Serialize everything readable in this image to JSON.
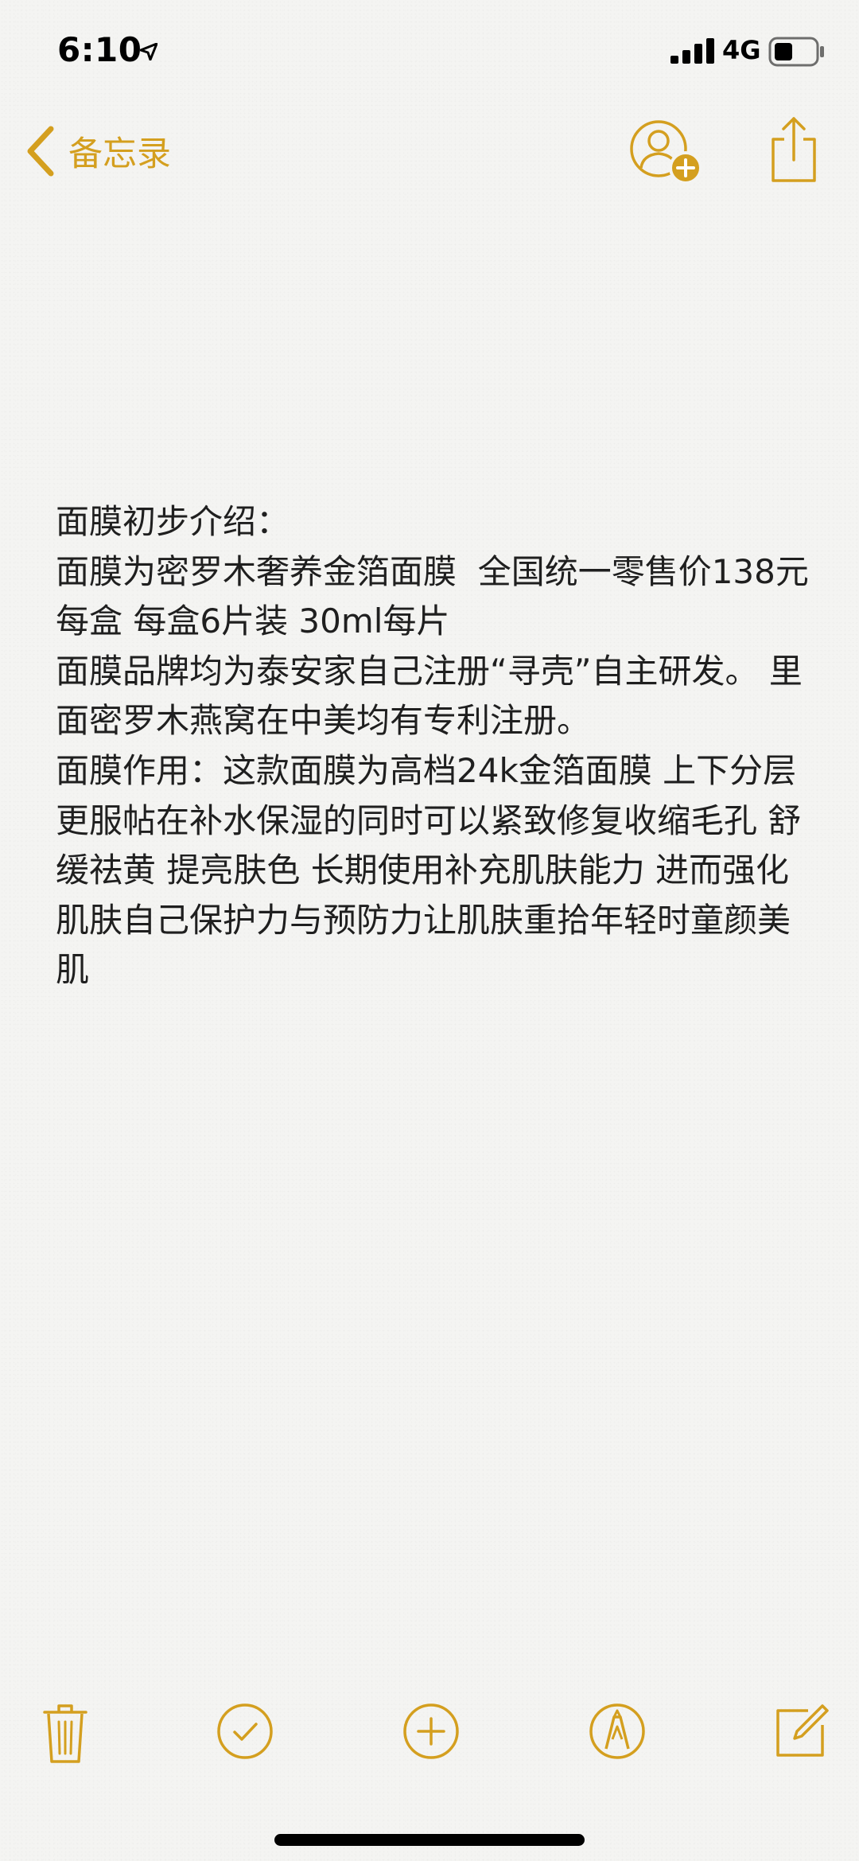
{
  "status_bar": {
    "time": "6:10",
    "network": "4G"
  },
  "nav": {
    "back_label": "备忘录"
  },
  "note": {
    "text": "面膜初步介绍：\n面膜为密罗木奢养金箔面膜  全国统一零售价138元每盒 每盒6片装 30ml每片\n面膜品牌均为泰安家自己注册“寻壳”自主研发。 里面密罗木燕窝在中美均有专利注册。\n面膜作用：这款面膜为高档24k金箔面膜 上下分层更服帖在补水保湿的同时可以紧致修复收缩毛孔 舒缓祛黄 提亮肤色 长期使用补充肌肤能力 进而强化肌肤自己保护力与预防力让肌肤重拾年轻时童颜美肌"
  },
  "colors": {
    "accent": "#d49f1f",
    "background": "#f4f4f2",
    "text": "#1f1f1f"
  },
  "icons": [
    "location-arrow-icon",
    "signal-icon",
    "battery-icon",
    "chevron-left-icon",
    "add-person-icon",
    "share-icon",
    "trash-icon",
    "checklist-icon",
    "plus-icon",
    "markup-icon",
    "compose-icon"
  ]
}
